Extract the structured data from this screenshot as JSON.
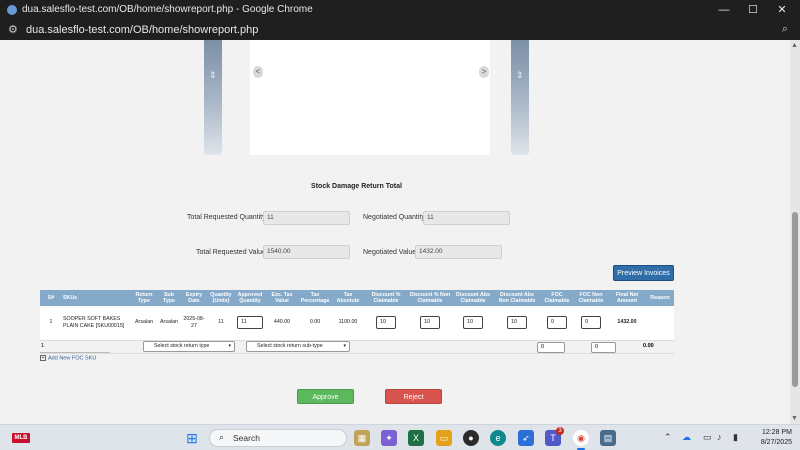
{
  "window": {
    "title": "dua.salesflo-test.com/OB/home/showreport.php - Google Chrome",
    "url": "dua.salesflo-test.com/OB/home/showreport.php",
    "minimize": "—",
    "maximize": "☐",
    "close": "✕",
    "zoom_icon": "zoom-icon"
  },
  "viewer": {
    "prev": "<",
    "next": ">"
  },
  "section": {
    "title": "Stock Damage Return Total"
  },
  "summary": {
    "total_requested_quantity_label": "Total Requested Quantity",
    "total_requested_quantity": "11",
    "negotiated_quantity_label": "Negotiated Quantity",
    "negotiated_quantity": "11",
    "total_requested_value_label": "Total Requested Value",
    "total_requested_value": "1540.00",
    "negotiated_value_label": "Negotiated Value",
    "negotiated_value": "1432.00"
  },
  "preview_button": "Preview Invoices",
  "table": {
    "headers": [
      "S#",
      "SKUs",
      "Return Type",
      "Sub Type",
      "Expiry Date",
      "Quantity (Units)",
      "Approved Quantity",
      "Exc. Tax Value",
      "Tax Percentage",
      "Tax Absolute",
      "Discount % Claimable",
      "Discount % Non Claimable",
      "Discount Abs Claimable",
      "Discount Abs Non Claimable",
      "FOC Claimable",
      "FOC Non Claimable",
      "Final Net Amount",
      "Reason"
    ],
    "rows": [
      {
        "sno": "1",
        "sku": "SOOPER SOFT BAKES PLAIN CAKE [SKU00015]",
        "return_type": "Arsalan",
        "sub_type": "Arsalan",
        "expiry_date": "2025-08-27",
        "quantity": "11",
        "approved_quantity": "11",
        "exc_tax_value": "440.00",
        "tax_percentage": "0.00",
        "tax_absolute": "1100.00",
        "discount_pct_claimable": "10",
        "discount_pct_non_claimable": "10",
        "discount_abs_claimable": "10",
        "discount_abs_non_claimable": "10",
        "foc_claimable": "0",
        "foc_non_claimable": "0",
        "final_net_amount": "1432.00",
        "reason": ""
      }
    ]
  },
  "totals_row": {
    "count": "1",
    "return_type_placeholder": "Select stock return type",
    "sub_type_placeholder": "Select stock return sub-type",
    "foc_claimable": "0",
    "foc_non_claimable": "0",
    "final_net_amount": "0.00"
  },
  "add_foc_link": "Add New FOC SKU",
  "actions": {
    "approve": "Approve",
    "reject": "Reject"
  },
  "taskbar": {
    "weather_badge": "MLB",
    "search_placeholder": "Search",
    "teams_badge": "3",
    "time": "12:28 PM",
    "date": "8/27/2025"
  }
}
